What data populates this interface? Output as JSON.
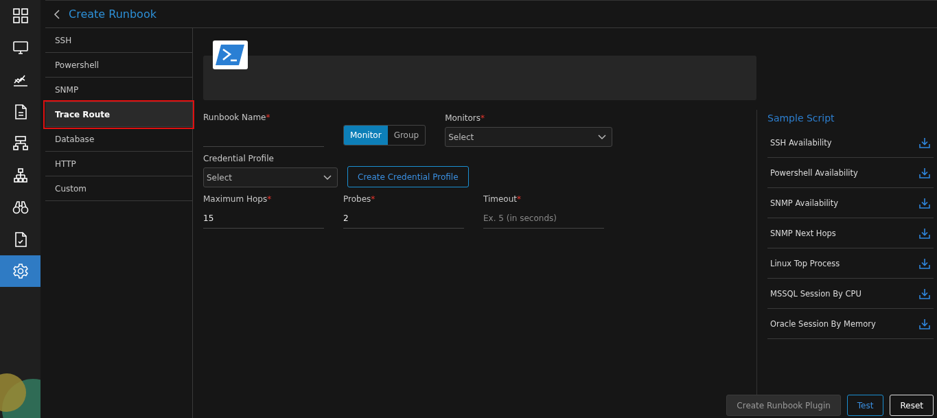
{
  "rail": [
    {
      "kind": "grid",
      "selected": false
    },
    {
      "kind": "monitor",
      "selected": false
    },
    {
      "kind": "chart",
      "selected": false
    },
    {
      "kind": "document",
      "selected": false
    },
    {
      "kind": "network",
      "selected": false
    },
    {
      "kind": "hierarchy",
      "selected": false
    },
    {
      "kind": "binoculars",
      "selected": false
    },
    {
      "kind": "checklist",
      "selected": false
    },
    {
      "kind": "gear",
      "selected": true
    }
  ],
  "header": {
    "title": "Create Runbook"
  },
  "types": [
    {
      "label": "SSH",
      "selected": false,
      "annotated": false
    },
    {
      "label": "Powershell",
      "selected": false,
      "annotated": false
    },
    {
      "label": "SNMP",
      "selected": false,
      "annotated": false
    },
    {
      "label": "Trace Route",
      "selected": true,
      "annotated": true
    },
    {
      "label": "Database",
      "selected": false,
      "annotated": false
    },
    {
      "label": "HTTP",
      "selected": false,
      "annotated": false
    },
    {
      "label": "Custom",
      "selected": false,
      "annotated": false
    }
  ],
  "form": {
    "runbook_name": {
      "label": "Runbook Name",
      "required_mark": "*"
    },
    "target_toggle": [
      {
        "label": "Monitor",
        "selected": true
      },
      {
        "label": "Group",
        "selected": false
      }
    ],
    "monitors": {
      "label": "Monitors",
      "required_mark": "*",
      "value": "Select"
    },
    "credential_profile": {
      "label": "Credential Profile",
      "value": "Select"
    },
    "create_credential_button": "Create Credential Profile",
    "maximum_hops": {
      "label": "Maximum Hops",
      "required_mark": "*",
      "value": "15"
    },
    "probes": {
      "label": "Probes",
      "required_mark": "*",
      "value": "2"
    },
    "timeout": {
      "label": "Timeout",
      "required_mark": "*",
      "placeholder": "Ex. 5 (in seconds)"
    }
  },
  "sample_script": {
    "title": "Sample Script",
    "items": [
      "SSH Availability",
      "Powershell Availability",
      "SNMP Availability",
      "SNMP Next Hops",
      "Linux Top Process",
      "MSSQL Session By CPU",
      "Oracle Session By Memory"
    ]
  },
  "footer": {
    "buttons": [
      {
        "label": "Create Runbook Plugin",
        "kind": "disabled"
      },
      {
        "label": "Test",
        "kind": "outline"
      },
      {
        "label": "Reset",
        "kind": "plain"
      }
    ]
  }
}
